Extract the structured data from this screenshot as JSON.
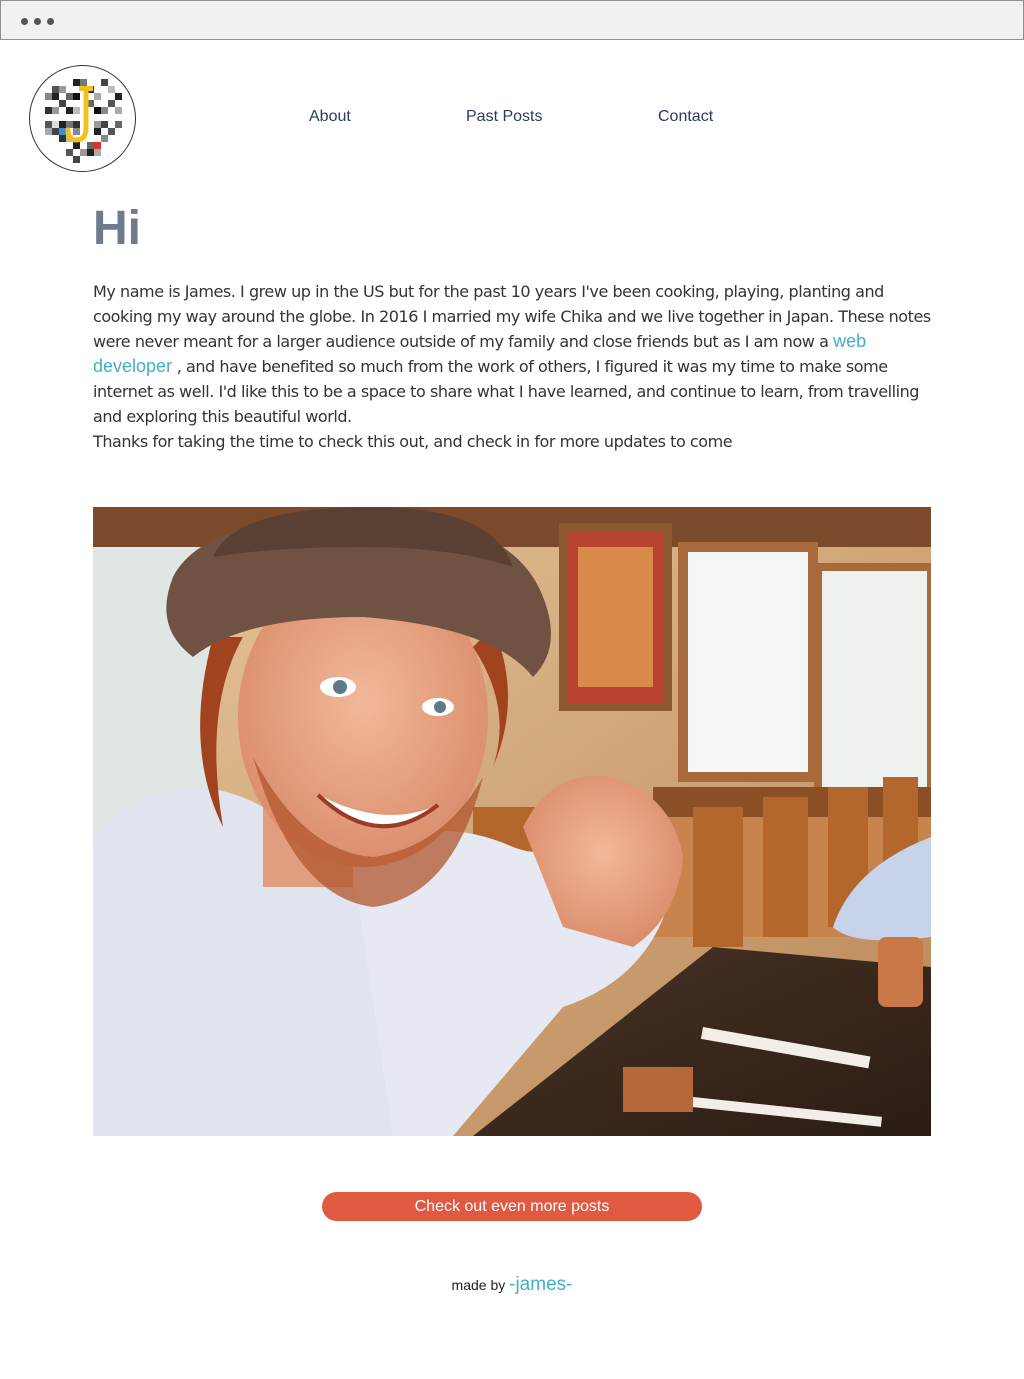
{
  "nav": {
    "about": "About",
    "past_posts": "Past Posts",
    "contact": "Contact"
  },
  "main": {
    "greeting": "Hi",
    "intro_before_link": "My name is James. I grew up in the US but for the past 10 years I've been cooking, playing, planting and cooking my way around the globe. In 2016 I married my wife Chika and we live together in Japan. These notes were never meant for a larger audience outside of my family and close friends but as I am now a ",
    "intro_link": "web developer",
    "intro_after_link": " , and have benefited so much from the work of others, I figured it was my time to make some internet as well. I'd like this to be a space to share what I have learned, and continue to learn, from travelling and exploring this beautiful world.",
    "thanks": "Thanks for taking the time to check this out, and check in for more updates to come",
    "cta_label": "Check out even more posts"
  },
  "footer": {
    "made_by": "made by",
    "author_link": "-james-"
  },
  "colors": {
    "accent_link": "#3fb1c0",
    "cta_background": "#e05a42",
    "nav_text": "#2b3a5e",
    "greeting_text": "#6e7b8d"
  },
  "icons": {
    "logo": "pixel-mosaic-j-logo-icon",
    "window_controls": "three-dots-icon"
  }
}
